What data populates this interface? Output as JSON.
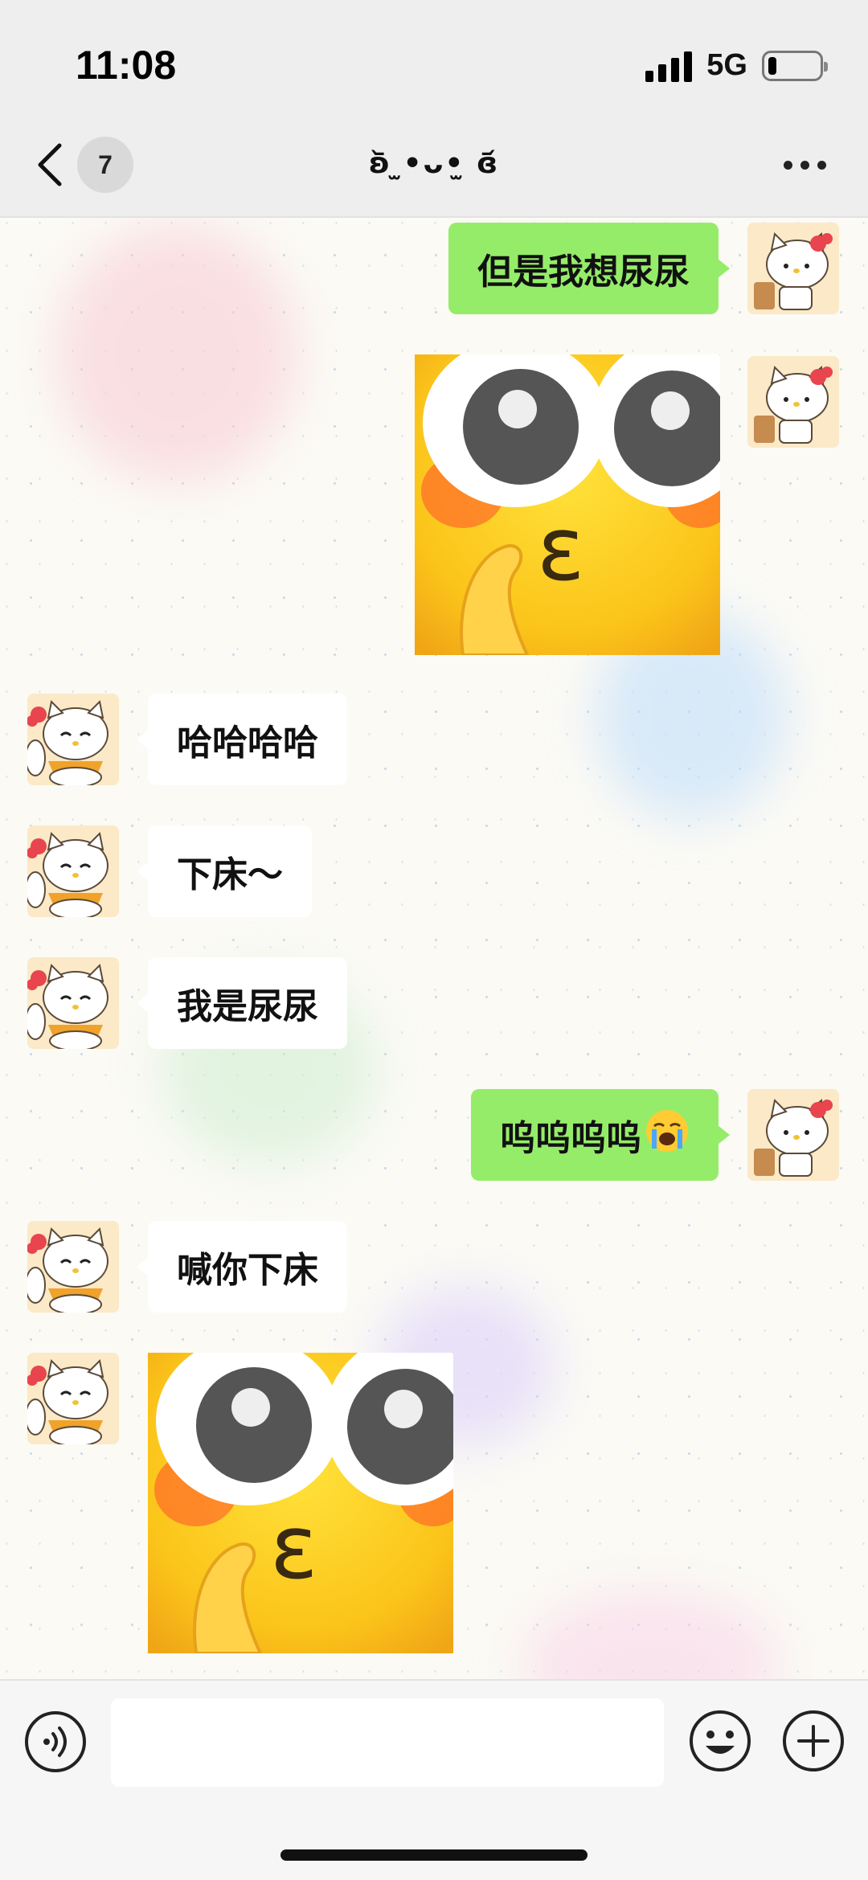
{
  "status_bar": {
    "time": "11:08",
    "network": "5G",
    "battery_level": 0.15,
    "signal_bars": 4
  },
  "header": {
    "unread_count": "7",
    "title": "ʚ᷅ ̫•ᴗ•̫ ɞ᷄",
    "icons": [
      "chevron-left-icon",
      "more-icon"
    ]
  },
  "messages": [
    {
      "side": "out",
      "type": "text",
      "text": "但是我想尿尿"
    },
    {
      "side": "out",
      "type": "sticker",
      "sticker": "yellow-face-shush-sticker"
    },
    {
      "side": "in",
      "type": "text",
      "text": "哈哈哈哈"
    },
    {
      "side": "in",
      "type": "text",
      "text": "下床～"
    },
    {
      "side": "in",
      "type": "text",
      "text": "我是尿尿"
    },
    {
      "side": "out",
      "type": "text",
      "text": "呜呜呜呜",
      "emoji": "loudly-crying-face"
    },
    {
      "side": "in",
      "type": "text",
      "text": "喊你下床"
    },
    {
      "side": "in",
      "type": "sticker",
      "sticker": "yellow-face-shush-sticker"
    }
  ],
  "input_bar": {
    "input_value": "",
    "icons": [
      "voice-icon",
      "emoji-icon",
      "plus-icon"
    ]
  },
  "colors": {
    "outgoing_bubble": "#95ec69",
    "incoming_bubble": "#ffffff",
    "header_bg": "#eeeeee"
  }
}
